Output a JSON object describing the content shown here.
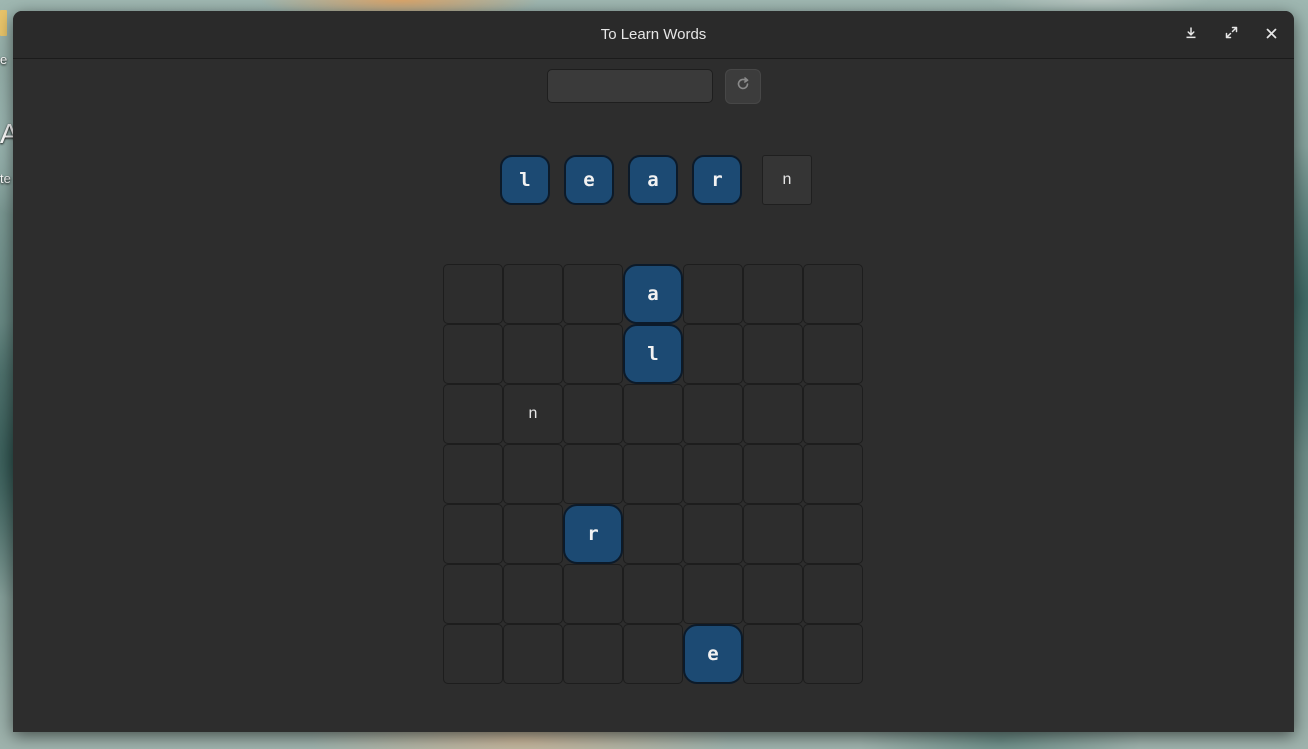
{
  "window": {
    "title": "To Learn Words"
  },
  "desktop": {
    "fragments": [
      "e",
      "A",
      "te"
    ]
  },
  "header_buttons": [
    {
      "name": "download",
      "icon": "download-icon"
    },
    {
      "name": "fullscreen",
      "icon": "expand-icon"
    },
    {
      "name": "close",
      "icon": "close-icon"
    }
  ],
  "toolbar": {
    "input_value": "",
    "input_placeholder": "",
    "refresh_icon": "refresh-icon"
  },
  "word": {
    "target": "learn",
    "letters": [
      {
        "char": "l",
        "state": "found"
      },
      {
        "char": "e",
        "state": "found"
      },
      {
        "char": "a",
        "state": "found"
      },
      {
        "char": "r",
        "state": "found"
      },
      {
        "char": "n",
        "state": "pending"
      }
    ]
  },
  "grid": {
    "rows": 7,
    "cols": 7,
    "cells": [
      [
        "",
        "",
        "",
        "a",
        "",
        "",
        ""
      ],
      [
        "",
        "",
        "",
        "l",
        "",
        "",
        ""
      ],
      [
        "",
        "n",
        "",
        "",
        "",
        "",
        ""
      ],
      [
        "",
        "",
        "",
        "",
        "",
        "",
        ""
      ],
      [
        "",
        "",
        "r",
        "",
        "",
        "",
        ""
      ],
      [
        "",
        "",
        "",
        "",
        "",
        "",
        ""
      ],
      [
        "",
        "",
        "",
        "",
        "e",
        "",
        ""
      ]
    ],
    "found": [
      [
        false,
        false,
        false,
        true,
        false,
        false,
        false
      ],
      [
        false,
        false,
        false,
        true,
        false,
        false,
        false
      ],
      [
        false,
        false,
        false,
        false,
        false,
        false,
        false
      ],
      [
        false,
        false,
        false,
        false,
        false,
        false,
        false
      ],
      [
        false,
        false,
        true,
        false,
        false,
        false,
        false
      ],
      [
        false,
        false,
        false,
        false,
        false,
        false,
        false
      ],
      [
        false,
        false,
        false,
        false,
        true,
        false,
        false
      ]
    ]
  },
  "colors": {
    "found_tile": "#1c4a73",
    "found_border": "#0c1a29",
    "window_bg": "#2d2d2d",
    "headerbar_bg": "#2a2a2a"
  }
}
